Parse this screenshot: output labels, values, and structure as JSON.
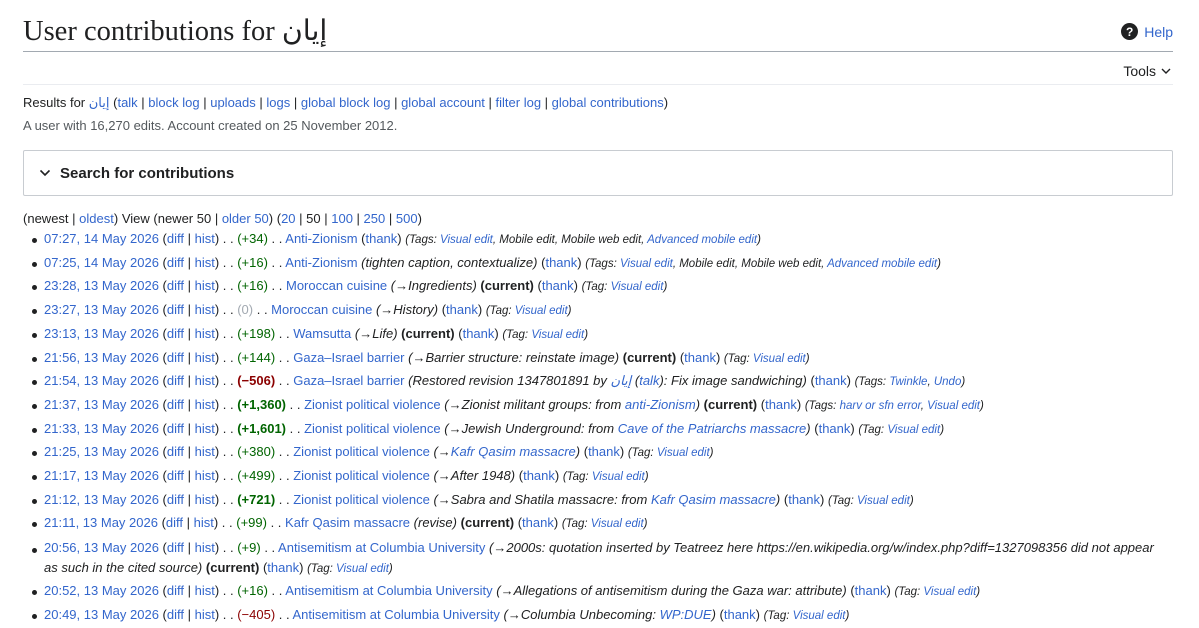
{
  "page": {
    "title_prefix": "User contributions for ",
    "username": "إيان",
    "help_label": "Help",
    "tools_label": "Tools"
  },
  "results": {
    "prefix": "Results for ",
    "user": "إيان",
    "links": [
      "talk",
      "block log",
      "uploads",
      "logs",
      "global block log",
      "global account",
      "filter log",
      "global contributions"
    ]
  },
  "account_info": "A user with 16,270 edits. Account created on 25 November 2012.",
  "search": {
    "label": "Search for contributions"
  },
  "nav": {
    "newest": "newest",
    "oldest": "oldest",
    "view": "View",
    "newer": "newer 50",
    "older": "older 50",
    "limits": [
      "20",
      "50",
      "100",
      "250",
      "500"
    ]
  },
  "contributions": [
    {
      "time": "07:27, 14 May 2026",
      "size": "+34",
      "article": "Anti-Zionism",
      "comment": "",
      "current": false,
      "tags_label": "Tags:",
      "tags": [
        "Visual edit",
        "Mobile edit",
        "Mobile web edit",
        "Advanced mobile edit"
      ]
    },
    {
      "time": "07:25, 14 May 2026",
      "size": "+16",
      "article": "Anti-Zionism",
      "comment": "tighten caption, contextualize",
      "current": false,
      "tags_label": "Tags:",
      "tags": [
        "Visual edit",
        "Mobile edit",
        "Mobile web edit",
        "Advanced mobile edit"
      ]
    },
    {
      "time": "23:28, 13 May 2026",
      "size": "+16",
      "article": "Moroccan cuisine",
      "comment": "→Ingredients",
      "current": true,
      "tags_label": "Tag:",
      "tags": [
        "Visual edit"
      ]
    },
    {
      "time": "23:27, 13 May 2026",
      "size": "0",
      "article": "Moroccan cuisine",
      "comment": "→History",
      "current": false,
      "tags_label": "Tag:",
      "tags": [
        "Visual edit"
      ]
    },
    {
      "time": "23:13, 13 May 2026",
      "size": "+198",
      "article": "Wamsutta",
      "comment": "→Life",
      "current": true,
      "tags_label": "Tag:",
      "tags": [
        "Visual edit"
      ]
    },
    {
      "time": "21:56, 13 May 2026",
      "size": "+144",
      "article": "Gaza–Israel barrier",
      "comment": "→Barrier structure: reinstate image",
      "current": true,
      "tags_label": "Tag:",
      "tags": [
        "Visual edit"
      ]
    },
    {
      "time": "21:54, 13 May 2026",
      "size": "−506",
      "article": "Gaza–Israel barrier",
      "comment": "Restored revision 1347801891 by إيان (talk): Fix image sandwiching",
      "current": false,
      "tags_label": "Tags:",
      "tags": [
        "Twinkle",
        "Undo"
      ]
    },
    {
      "time": "21:37, 13 May 2026",
      "size": "+1,360",
      "article": "Zionist political violence",
      "comment": "→Zionist militant groups: from anti-Zionism",
      "current": true,
      "tags_label": "Tags:",
      "tags": [
        "harv or sfn error",
        "Visual edit"
      ]
    },
    {
      "time": "21:33, 13 May 2026",
      "size": "+1,601",
      "article": "Zionist political violence",
      "comment": "→Jewish Underground: from Cave of the Patriarchs massacre",
      "current": false,
      "tags_label": "Tag:",
      "tags": [
        "Visual edit"
      ]
    },
    {
      "time": "21:25, 13 May 2026",
      "size": "+380",
      "article": "Zionist political violence",
      "comment": "→Kafr Qasim massacre",
      "current": false,
      "tags_label": "Tag:",
      "tags": [
        "Visual edit"
      ]
    },
    {
      "time": "21:17, 13 May 2026",
      "size": "+499",
      "article": "Zionist political violence",
      "comment": "→After 1948",
      "current": false,
      "tags_label": "Tag:",
      "tags": [
        "Visual edit"
      ]
    },
    {
      "time": "21:12, 13 May 2026",
      "size": "+721",
      "article": "Zionist political violence",
      "comment": "→Sabra and Shatila massacre: from Kafr Qasim massacre",
      "current": false,
      "tags_label": "Tag:",
      "tags": [
        "Visual edit"
      ]
    },
    {
      "time": "21:11, 13 May 2026",
      "size": "+99",
      "article": "Kafr Qasim massacre",
      "comment": "revise",
      "current": true,
      "tags_label": "Tag:",
      "tags": [
        "Visual edit"
      ]
    },
    {
      "time": "20:56, 13 May 2026",
      "size": "+9",
      "article": "Antisemitism at Columbia University",
      "comment": "→2000s: quotation inserted by Teatreez here https://en.wikipedia.org/w/index.php?diff=1327098356 did not appear as such in the cited source",
      "current": true,
      "tags_label": "Tag:",
      "tags": [
        "Visual edit"
      ]
    },
    {
      "time": "20:52, 13 May 2026",
      "size": "+16",
      "article": "Antisemitism at Columbia University",
      "comment": "→Allegations of antisemitism during the Gaza war: attribute",
      "current": false,
      "tags_label": "Tag:",
      "tags": [
        "Visual edit"
      ]
    },
    {
      "time": "20:49, 13 May 2026",
      "size": "−405",
      "article": "Antisemitism at Columbia University",
      "comment": "→Columbia Unbecoming: WP:DUE",
      "current": false,
      "tags_label": "Tag:",
      "tags": [
        "Visual edit"
      ]
    }
  ],
  "labels": {
    "diff": "diff",
    "hist": "hist",
    "current": "current",
    "thank": "thank",
    "sep": ". ."
  },
  "colors": {
    "link": "#3366cc",
    "positive": "#006400",
    "negative": "#8b0000",
    "neutral": "#a2a9b1"
  }
}
